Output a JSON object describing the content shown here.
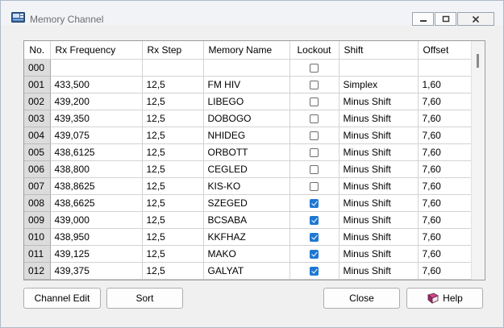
{
  "window": {
    "title": "Memory Channel"
  },
  "columns": [
    "No.",
    "Rx Frequency",
    "Rx Step",
    "Memory Name",
    "Lockout",
    "Shift",
    "Offset"
  ],
  "rows": [
    {
      "no": "000",
      "freq": "",
      "step": "",
      "name": "",
      "lockout": false,
      "shift": "",
      "offset": ""
    },
    {
      "no": "001",
      "freq": "433,500",
      "step": "12,5",
      "name": "FM HIV",
      "lockout": false,
      "shift": "Simplex",
      "offset": "1,60"
    },
    {
      "no": "002",
      "freq": "439,200",
      "step": "12,5",
      "name": "LIBEGO",
      "lockout": false,
      "shift": "Minus Shift",
      "offset": "7,60"
    },
    {
      "no": "003",
      "freq": "439,350",
      "step": "12,5",
      "name": "DOBOGO",
      "lockout": false,
      "shift": "Minus Shift",
      "offset": "7,60"
    },
    {
      "no": "004",
      "freq": "439,075",
      "step": "12,5",
      "name": "NHIDEG",
      "lockout": false,
      "shift": "Minus Shift",
      "offset": "7,60"
    },
    {
      "no": "005",
      "freq": "438,6125",
      "step": "12,5",
      "name": "ORBOTT",
      "lockout": false,
      "shift": "Minus Shift",
      "offset": "7,60"
    },
    {
      "no": "006",
      "freq": "438,800",
      "step": "12,5",
      "name": "CEGLED",
      "lockout": false,
      "shift": "Minus Shift",
      "offset": "7,60"
    },
    {
      "no": "007",
      "freq": "438,8625",
      "step": "12,5",
      "name": "KIS-KO",
      "lockout": false,
      "shift": "Minus Shift",
      "offset": "7,60"
    },
    {
      "no": "008",
      "freq": "438,6625",
      "step": "12,5",
      "name": "SZEGED",
      "lockout": true,
      "shift": "Minus Shift",
      "offset": "7,60"
    },
    {
      "no": "009",
      "freq": "439,000",
      "step": "12,5",
      "name": "BCSABA",
      "lockout": true,
      "shift": "Minus Shift",
      "offset": "7,60"
    },
    {
      "no": "010",
      "freq": "438,950",
      "step": "12,5",
      "name": "KKFHAZ",
      "lockout": true,
      "shift": "Minus Shift",
      "offset": "7,60"
    },
    {
      "no": "011",
      "freq": "439,125",
      "step": "12,5",
      "name": "MAKO",
      "lockout": true,
      "shift": "Minus Shift",
      "offset": "7,60"
    },
    {
      "no": "012",
      "freq": "439,375",
      "step": "12,5",
      "name": "GALYAT",
      "lockout": true,
      "shift": "Minus Shift",
      "offset": "7,60"
    }
  ],
  "buttons": {
    "channel_edit": "Channel Edit",
    "sort": "Sort",
    "close": "Close",
    "help": "Help"
  },
  "colors": {
    "checkbox_checked": "#1e78d2",
    "row_header": "#dcdcdc"
  }
}
